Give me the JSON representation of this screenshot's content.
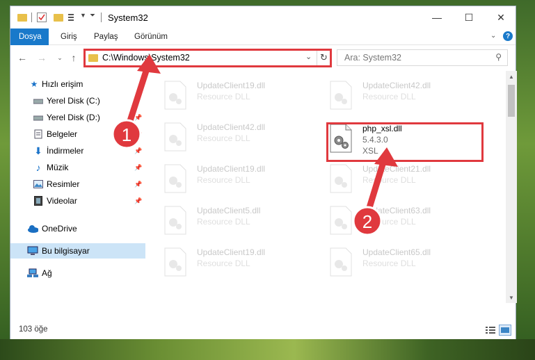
{
  "title_bar": {
    "title": "System32",
    "controls": [
      "—",
      "☐",
      "✕"
    ]
  },
  "ribbon": {
    "tabs": [
      "Dosya",
      "Giriş",
      "Paylaş",
      "Görünüm"
    ]
  },
  "navigation": {
    "address": "C:\\Windows\\System32",
    "search_placeholder": "Ara: System32"
  },
  "sidebar": {
    "items": [
      {
        "label": "Hızlı erişim",
        "icon": "star-icon"
      },
      {
        "label": "Yerel Disk (C:)",
        "icon": "drive-icon"
      },
      {
        "label": "Yerel Disk (D:)",
        "icon": "drive-icon"
      },
      {
        "label": "Belgeler",
        "icon": "documents-icon"
      },
      {
        "label": "İndirmeler",
        "icon": "download-icon"
      },
      {
        "label": "Müzik",
        "icon": "music-icon"
      },
      {
        "label": "Resimler",
        "icon": "pictures-icon"
      },
      {
        "label": "Videolar",
        "icon": "video-icon"
      },
      {
        "label": "OneDrive",
        "icon": "cloud-icon"
      },
      {
        "label": "Bu bilgisayar",
        "icon": "computer-icon"
      },
      {
        "label": "Ağ",
        "icon": "network-icon"
      }
    ]
  },
  "files": [
    {
      "name": "UpdateClient19.dll",
      "desc": "Resource DLL"
    },
    {
      "name": "UpdateClient42.dll",
      "desc": "Resource DLL"
    },
    {
      "name": "UpdateClient42.dll",
      "desc": "Resource DLL"
    },
    {
      "name": "php_xsl.dll",
      "desc": "5.4.3.0",
      "desc2": "XSL"
    },
    {
      "name": "UpdateClient19.dll",
      "desc": "Resource DLL"
    },
    {
      "name": "UpdateClient21.dll",
      "desc": "Resource DLL"
    },
    {
      "name": "UpdateClient5.dll",
      "desc": "Resource DLL"
    },
    {
      "name": "UpdateClient63.dll",
      "desc": "Resource DLL"
    },
    {
      "name": "UpdateClient19.dll",
      "desc": "Resource DLL"
    },
    {
      "name": "UpdateClient65.dll",
      "desc": "Resource DLL"
    }
  ],
  "status": {
    "count": "103 öğe"
  },
  "annotations": {
    "step1": "1",
    "step2": "2",
    "color": "#e0393e"
  }
}
